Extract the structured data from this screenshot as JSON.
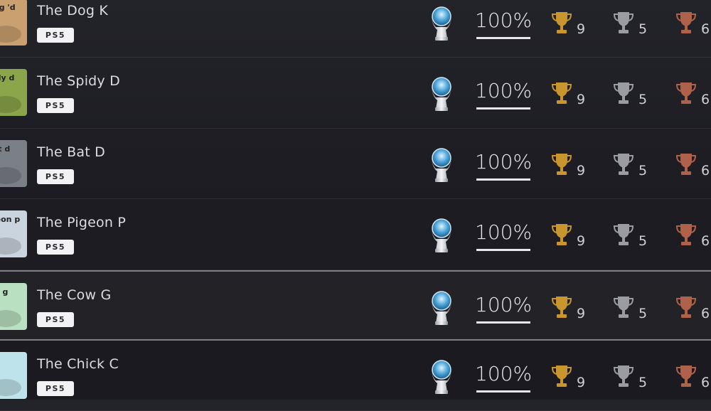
{
  "colors": {
    "gold": "#c9962e",
    "silver": "#9a9ca2",
    "bronze": "#b0614a",
    "platinum": "#4aa3d8"
  },
  "games": [
    {
      "title": "The Dog K",
      "platform": "PS5",
      "progress_label": "100%",
      "progress": 1.0,
      "gold": "9",
      "silver": "5",
      "bronze": "6",
      "thumb_color": "#caa070",
      "thumb_text": "Dog 'd"
    },
    {
      "title": "The Spidy D",
      "platform": "PS5",
      "progress_label": "100%",
      "progress": 1.0,
      "gold": "9",
      "silver": "5",
      "bronze": "6",
      "thumb_color": "#8aa54a",
      "thumb_text": "pidy d"
    },
    {
      "title": "The Bat D",
      "platform": "PS5",
      "progress_label": "100%",
      "progress": 1.0,
      "gold": "9",
      "silver": "5",
      "bronze": "6",
      "thumb_color": "#7b7f86",
      "thumb_text": "bat d"
    },
    {
      "title": "The Pigeon P",
      "platform": "PS5",
      "progress_label": "100%",
      "progress": 1.0,
      "gold": "9",
      "silver": "5",
      "bronze": "6",
      "thumb_color": "#c9d4df",
      "thumb_text": "igeon p"
    },
    {
      "title": "The Cow G",
      "platform": "PS5",
      "progress_label": "100%",
      "progress": 1.0,
      "gold": "9",
      "silver": "5",
      "bronze": "6",
      "thumb_color": "#b9e0c0",
      "thumb_text": "ow g"
    },
    {
      "title": "The Chick C",
      "platform": "PS5",
      "progress_label": "100%",
      "progress": 1.0,
      "gold": "9",
      "silver": "5",
      "bronze": "6",
      "thumb_color": "#bfe3ea",
      "thumb_text": ""
    }
  ]
}
